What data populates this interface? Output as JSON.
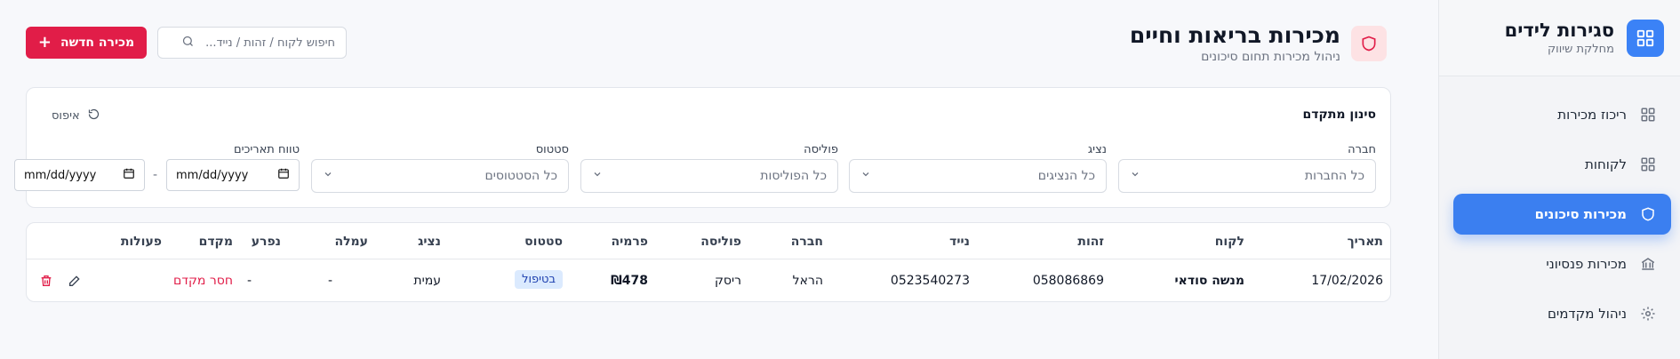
{
  "sidebar": {
    "title": "סגירות לידים",
    "subtitle": "מחלקת שיווק",
    "items": [
      {
        "label": "ריכוז מכירות",
        "icon": "grid-icon"
      },
      {
        "label": "לקוחות",
        "icon": "grid-icon"
      },
      {
        "label": "מכירות סיכונים",
        "icon": "shield-icon",
        "active": true
      },
      {
        "label": "מכירות פנסיוני",
        "icon": "bank-icon"
      },
      {
        "label": "ניהול מקדמים",
        "icon": "gear-icon"
      }
    ]
  },
  "header": {
    "title": "מכירות בריאות וחיים",
    "subtitle": "ניהול מכירות תחום סיכונים"
  },
  "toolbar": {
    "new_label": "מכירה חדשה",
    "search_placeholder": "חיפוש לקוח / זהות / נייד..."
  },
  "filters": {
    "title": "סינון מתקדם",
    "reset_label": "איפוס",
    "company": {
      "label": "חברה",
      "placeholder": "כל החברות"
    },
    "agent": {
      "label": "נציג",
      "placeholder": "כל הנציגים"
    },
    "policy": {
      "label": "פוליסה",
      "placeholder": "כל הפוליסות"
    },
    "status": {
      "label": "סטטוס",
      "placeholder": "כל הסטטוסים"
    },
    "date_range": {
      "label": "טווח תאריכים",
      "from": "mm/dd/yyyy",
      "to": "mm/dd/yyyy",
      "separator": "-"
    }
  },
  "table": {
    "columns": [
      "תאריך",
      "לקוח",
      "זהות",
      "נייד",
      "חברה",
      "פוליסה",
      "פרמיה",
      "סטטוס",
      "נציג",
      "עמלה",
      "נפרע",
      "מקדם",
      "פעולות"
    ],
    "rows": [
      {
        "date": "17/02/2026",
        "customer": "מנשה סודאי",
        "id": "058086869",
        "phone": "0523540273",
        "company": "הראל",
        "policy": "ריסק",
        "premium": "₪478",
        "status": "בטיפול",
        "agent": "עמית",
        "commission": "-",
        "paid": "-",
        "advance": "חסר מקדם"
      }
    ]
  },
  "colors": {
    "accent": "#e11d48",
    "primary": "#3b82f6",
    "badge_bg": "#dbeafe"
  }
}
